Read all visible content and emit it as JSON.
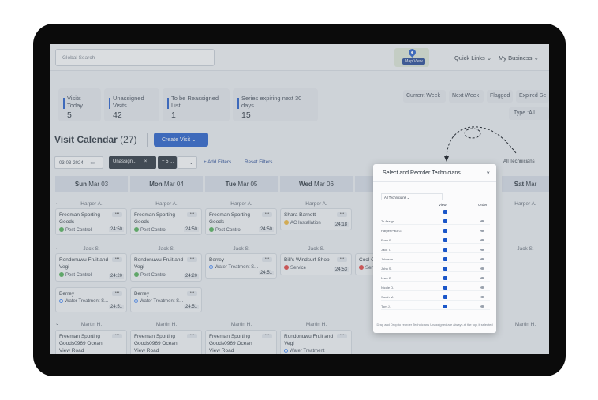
{
  "header": {
    "search_placeholder": "Global Search",
    "map_view_label": "Map View",
    "quick_links": "Quick Links",
    "my_business": "My Business"
  },
  "stats": [
    {
      "label": "Visits Today",
      "value": "5"
    },
    {
      "label": "Unassigned Visits",
      "value": "42"
    },
    {
      "label": "To be Reassigned List",
      "value": "1"
    },
    {
      "label": "Series expiring next 30 days",
      "value": "15"
    }
  ],
  "week_buttons": [
    "Current Week",
    "Next Week",
    "Flagged",
    "Expired Se"
  ],
  "type_filter": "Type :All",
  "calendar": {
    "title": "Visit Calendar",
    "count": "(27)",
    "create_label": "Create Visit",
    "date_value": "03-03-2024",
    "chip1": "Unassign...",
    "chip2": "+ 5 ...",
    "add_filters": "+ Add Filters",
    "reset_filters": "Reset Filters",
    "all_technicians": "All Technicians"
  },
  "days": [
    {
      "dow": "Sun",
      "date": "Mar 03"
    },
    {
      "dow": "Mon",
      "date": "Mar 04"
    },
    {
      "dow": "Tue",
      "date": "Mar 05"
    },
    {
      "dow": "Wed",
      "date": "Mar 06"
    },
    {
      "dow": "Sat",
      "date": "Mar"
    }
  ],
  "groups": [
    {
      "tech": "Harper A."
    },
    {
      "tech": "Jack S."
    },
    {
      "tech": "Martin H."
    }
  ],
  "cards": {
    "harper": [
      {
        "name": "Freeman Sporting Goods",
        "service": "Pest Control",
        "time": "24:50"
      },
      {
        "name": "Freeman Sporting Goods",
        "service": "Pest Control",
        "time": "24:50"
      },
      {
        "name": "Freeman Sporting Goods",
        "service": "Pest Control",
        "time": "24:50"
      },
      {
        "name": "Shara Barnett",
        "service": "AC Installation",
        "time": "24:18"
      }
    ],
    "jack": [
      {
        "name": "Rondonuwu Fruit and Vegi",
        "service": "Pest Control",
        "time": "24:20"
      },
      {
        "name": "Rondonuwu Fruit and Vegi",
        "service": "Pest Control",
        "time": "24:20"
      },
      {
        "name": "Berrey",
        "service": "Water Treatment S...",
        "time": "24:51"
      },
      {
        "name": "Bill's Windsurf Shop",
        "service": "Service",
        "time": "24:53"
      },
      {
        "name": "Cool C",
        "service": "Serv",
        "time": ""
      }
    ],
    "jack2": [
      {
        "name": "Berrey",
        "service": "Water Treatment S...",
        "time": "24:51"
      },
      {
        "name": "Berrey",
        "service": "Water Treatment S...",
        "time": "24:51"
      }
    ],
    "martin": [
      {
        "name": "Freeman Sporting Goods0969 Ocean View Road",
        "time": ""
      },
      {
        "name": "Freeman Sporting Goods0969 Ocean View Road",
        "time": ""
      },
      {
        "name": "Freeman Sporting Goods0969 Ocean View Road",
        "time": ""
      },
      {
        "name": "Rondonuwu Fruit and Vegi",
        "service": "Water Treatment",
        "time": ""
      }
    ]
  },
  "modal": {
    "title": "Select and Reorder Technicians",
    "close": "×",
    "select_label": "All Technicians",
    "col_view": "View",
    "col_order": "Order",
    "technicians": [
      "To Assign",
      "Harper Paul G.",
      "Evan B.",
      "Jack T.",
      "Johnson L.",
      "John S.",
      "Mark P.",
      "Nicole D.",
      "Sarah M.",
      "Tom J."
    ],
    "footer": "Drag and Drop to reorder Technicians Unassigned are always at the top, if selected"
  },
  "colors": {
    "accent": "#1a56c9",
    "device": "#0b0b0b"
  }
}
